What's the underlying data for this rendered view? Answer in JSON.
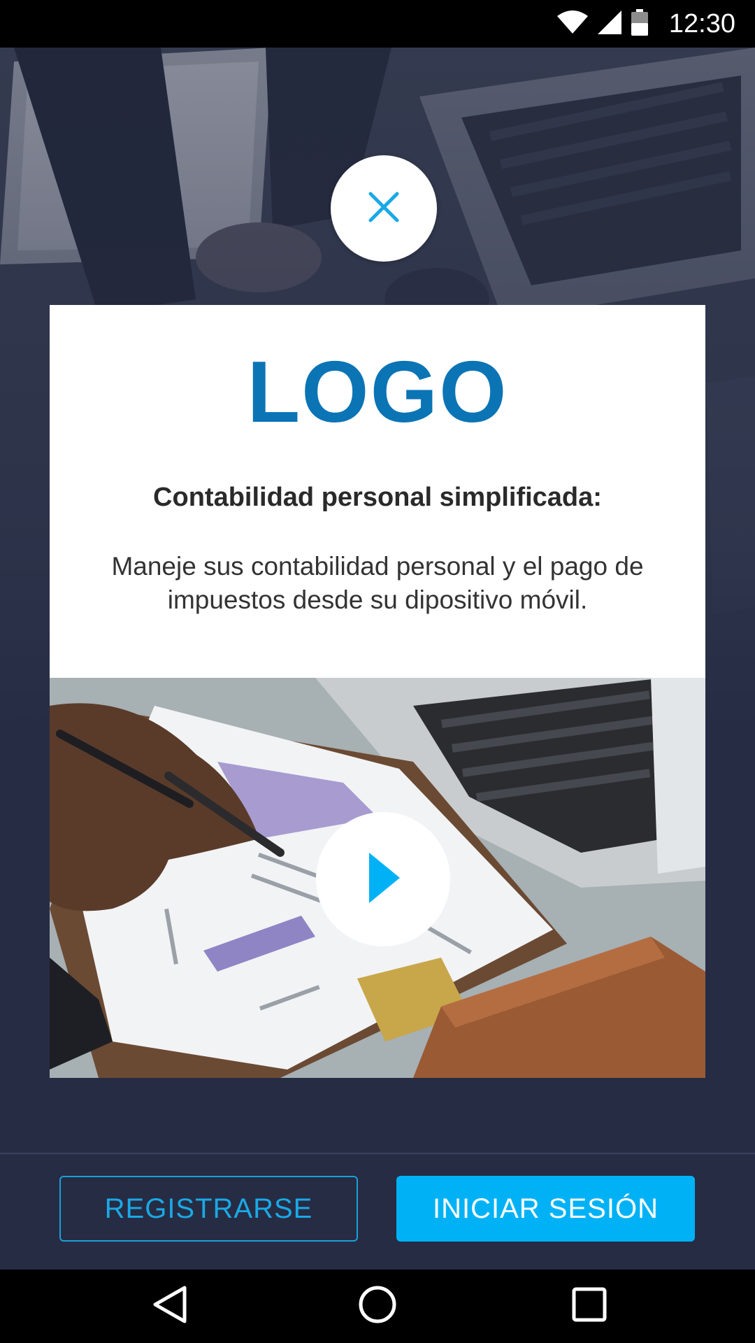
{
  "status_bar": {
    "time": "12:30",
    "icons": [
      "wifi-icon",
      "signal-icon",
      "battery-icon"
    ]
  },
  "close_button": {
    "icon": "close-icon"
  },
  "card": {
    "logo": "LOGO",
    "headline": "Contabilidad personal simplificada:",
    "description": "Maneje sus contabilidad personal y el pago de impuestos desde su dipositivo móvil."
  },
  "video": {
    "icon": "play-icon"
  },
  "actions": {
    "register_label": "REGISTRARSE",
    "login_label": "INICIAR SESIÓN"
  },
  "nav_bar": {
    "icons": [
      "back-icon",
      "home-icon",
      "recents-icon"
    ]
  },
  "colors": {
    "brand": "#0b74b5",
    "accent": "#00b2f5",
    "background": "#262c44"
  }
}
